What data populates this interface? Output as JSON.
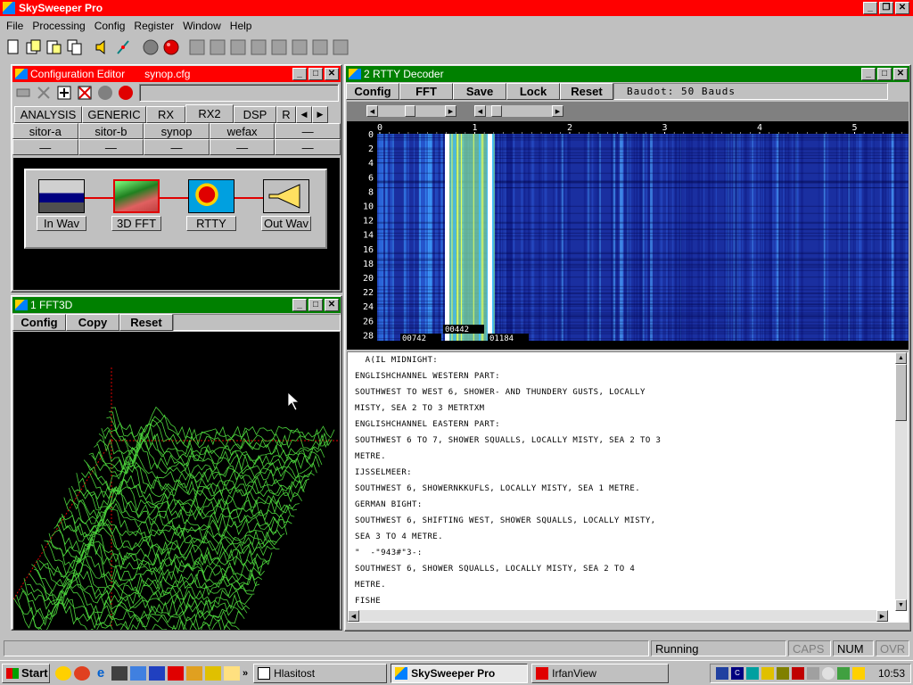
{
  "app": {
    "title": "SkySweeper Pro"
  },
  "menu": [
    "File",
    "Processing",
    "Config",
    "Register",
    "Window",
    "Help"
  ],
  "config_editor": {
    "title": "Configuration Editor",
    "file": "synop.cfg",
    "tabs": [
      "ANALYSIS",
      "GENERIC",
      "RX",
      "RX2",
      "DSP",
      "R"
    ],
    "row1": [
      "sitor-a",
      "sitor-b",
      "synop",
      "wefax",
      "—"
    ],
    "row2": [
      "—",
      "—",
      "—",
      "—",
      "—"
    ],
    "modules": [
      "In Wav",
      "3D FFT",
      "RTTY",
      "Out Wav"
    ]
  },
  "fft3d": {
    "title": "1 FFT3D",
    "buttons": [
      "Config",
      "Copy",
      "Reset"
    ]
  },
  "rtty": {
    "title": "2 RTTY Decoder",
    "buttons": [
      "Config",
      "FFT",
      "Save",
      "Lock",
      "Reset"
    ],
    "status": "Baudot: 50 Bauds",
    "x_ticks": [
      "0",
      "1",
      "2",
      "3",
      "4",
      "5"
    ],
    "y_ticks": [
      "0",
      "2",
      "4",
      "6",
      "8",
      "10",
      "12",
      "14",
      "16",
      "18",
      "20",
      "22",
      "24",
      "26",
      "28"
    ],
    "markers": [
      "00742",
      "00442",
      "01184"
    ],
    "text_lines": [
      "  A(IL MIDNIGHT:",
      "ENGLISHCHANNEL WESTERN PART:",
      "SOUTHWEST TO WEST 6, SHOWER- AND THUNDERY GUSTS, LOCALLY",
      "MISTY, SEA 2 TO 3 METRTXM",
      "ENGLISHCHANNEL EASTERN PART:",
      "SOUTHWEST 6 TO 7, SHOWER SQUALLS, LOCALLY MISTY, SEA 2 TO 3",
      "METRE.",
      "IJSSELMEER:",
      "SOUTHWEST 6, SHOWERNKKUFLS, LOCALLY MISTY, SEA 1 METRE.",
      "GERMAN BIGHT:",
      "SOUTHWEST 6, SHIFTING WEST, SHOWER SQUALLS, LOCALLY MISTY,",
      "SEA 3 TO 4 METRE.",
      "\"  -\"943#\"3-:",
      "SOUTHWEST 6, SHOWER SQUALLS, LOCALLY MISTY, SEA 2 TO 4",
      "METRE.",
      "FISHE"
    ]
  },
  "statusbar": {
    "status": "Running",
    "caps": "CAPS",
    "num": "NUM",
    "ovr": "OVR"
  },
  "taskbar": {
    "start": "Start",
    "tasks": [
      "Hlasitost",
      "SkySweeper Pro",
      "IrfanView"
    ],
    "time": "10:53"
  },
  "colors": {
    "titlebar_active": "#ff0000",
    "titlebar_green": "#008000",
    "waterfall": "#1a2fa0",
    "fft_line": "#4cd43c"
  }
}
